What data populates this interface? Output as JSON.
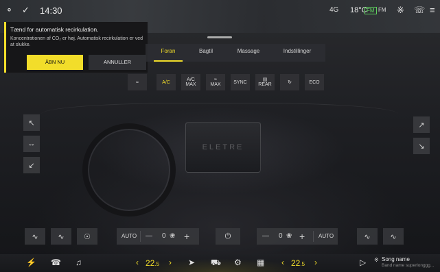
{
  "status": {
    "time": "14:30",
    "temperature": "18°C",
    "signal": "4G",
    "badge_green": "FM",
    "badge_other": "FM"
  },
  "notification": {
    "title": "Tænd for automatisk recirkulation.",
    "body": "Koncentrationen af CO₂ er høj. Automatisk recirkulation er ved at slukke.",
    "primary_label": "ÅBN NU",
    "secondary_label": "ANNULLER"
  },
  "tabs": [
    {
      "label": "Foran",
      "active": true
    },
    {
      "label": "Bagtil",
      "active": false
    },
    {
      "label": "Massage",
      "active": false
    },
    {
      "label": "Indstillinger",
      "active": false
    }
  ],
  "modes": [
    {
      "icon": "defrost-front-icon",
      "label": "",
      "active": false
    },
    {
      "icon": "",
      "label": "A/C",
      "active": true
    },
    {
      "icon": "",
      "label": "A/C MAX",
      "active": false
    },
    {
      "icon": "defrost-max-icon",
      "label": "MAX",
      "active": false
    },
    {
      "icon": "",
      "label": "SYNC",
      "active": false
    },
    {
      "icon": "defrost-rear-icon",
      "label": "REAR",
      "active": false
    },
    {
      "icon": "recirculation-icon",
      "label": "",
      "active": false
    },
    {
      "icon": "",
      "label": "ECO",
      "active": false
    }
  ],
  "climate": {
    "left_fan": {
      "mode": "AUTO",
      "level": "0"
    },
    "right_fan": {
      "mode": "AUTO",
      "level": "0"
    },
    "minus": "—",
    "plus": "+"
  },
  "center_screen_logo": "ELETRE",
  "dock": {
    "left_temp": "22",
    "left_temp_decimal": ".5",
    "right_temp": "22",
    "right_temp_decimal": ".5",
    "song": "Song name",
    "artist": "Band name superlonggg..."
  },
  "colors": {
    "accent": "#f2dd2a",
    "background": "#1c1d21"
  }
}
